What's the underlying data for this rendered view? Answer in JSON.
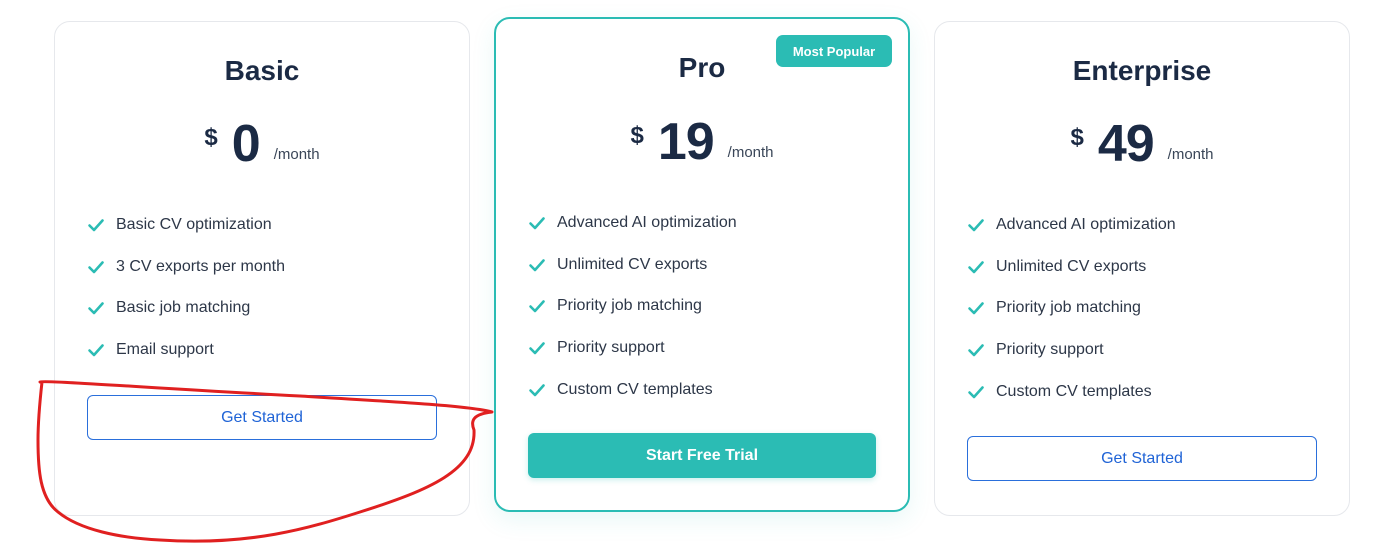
{
  "colors": {
    "accent": "#2bbcb4",
    "link": "#1f63d6",
    "heading": "#1b2a44",
    "annotation": "#e02020"
  },
  "basic": {
    "name": "Basic",
    "currency": "$",
    "amount": "0",
    "period": "/month",
    "features": [
      "Basic CV optimization",
      "3 CV exports per month",
      "Basic job matching",
      "Email support"
    ],
    "cta": "Get Started"
  },
  "pro": {
    "badge": "Most Popular",
    "name": "Pro",
    "currency": "$",
    "amount": "19",
    "period": "/month",
    "features": [
      "Advanced AI optimization",
      "Unlimited CV exports",
      "Priority job matching",
      "Priority support",
      "Custom CV templates"
    ],
    "cta": "Start Free Trial"
  },
  "enterprise": {
    "name": "Enterprise",
    "currency": "$",
    "amount": "49",
    "period": "/month",
    "features": [
      "Advanced AI optimization",
      "Unlimited CV exports",
      "Priority job matching",
      "Priority support",
      "Custom CV templates"
    ],
    "cta": "Get Started"
  },
  "icons": {
    "feature_bullet": "check-icon"
  }
}
